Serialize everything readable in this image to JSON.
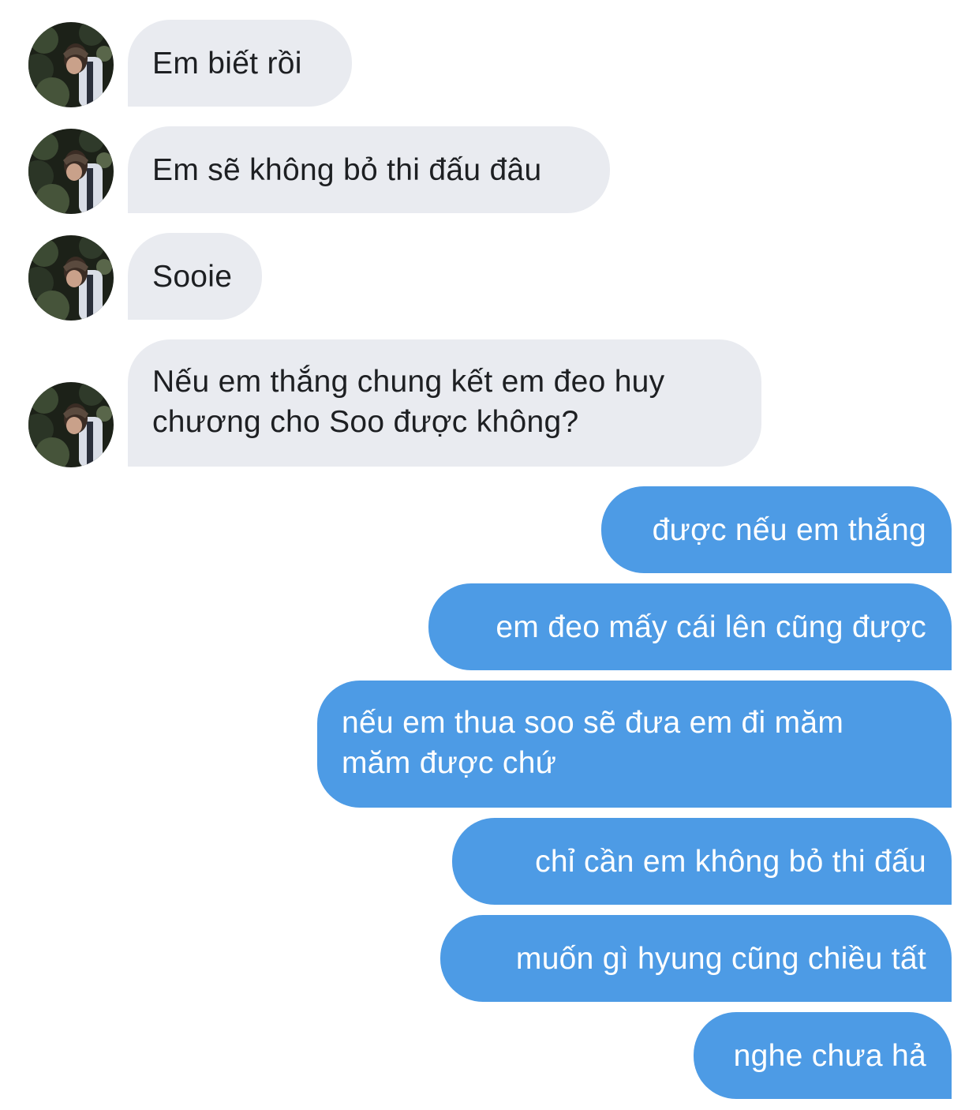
{
  "contact": {
    "avatar_icon": "profile-photo"
  },
  "colors": {
    "incoming_bubble": "#e9ebf0",
    "outgoing_bubble": "#4d9be5",
    "incoming_text": "#1d1f22",
    "outgoing_text": "#ffffff"
  },
  "messages": [
    {
      "direction": "incoming",
      "text": "Em biết rồi"
    },
    {
      "direction": "incoming",
      "text": "Em sẽ không bỏ thi đấu đâu"
    },
    {
      "direction": "incoming",
      "text": "Sooie"
    },
    {
      "direction": "incoming",
      "lines": [
        "Nếu em thắng chung kết em đeo huy",
        "chương cho Soo được không?"
      ]
    },
    {
      "direction": "outgoing",
      "text": "được nếu em thắng"
    },
    {
      "direction": "outgoing",
      "text": "em đeo mấy cái lên cũng được"
    },
    {
      "direction": "outgoing",
      "lines": [
        "nếu em thua soo sẽ đưa em đi măm",
        "măm được chứ"
      ]
    },
    {
      "direction": "outgoing",
      "text": "chỉ cần em không bỏ thi đấu"
    },
    {
      "direction": "outgoing",
      "text": "muốn gì hyung cũng chiều tất"
    },
    {
      "direction": "outgoing",
      "text": "nghe chưa hả"
    }
  ]
}
